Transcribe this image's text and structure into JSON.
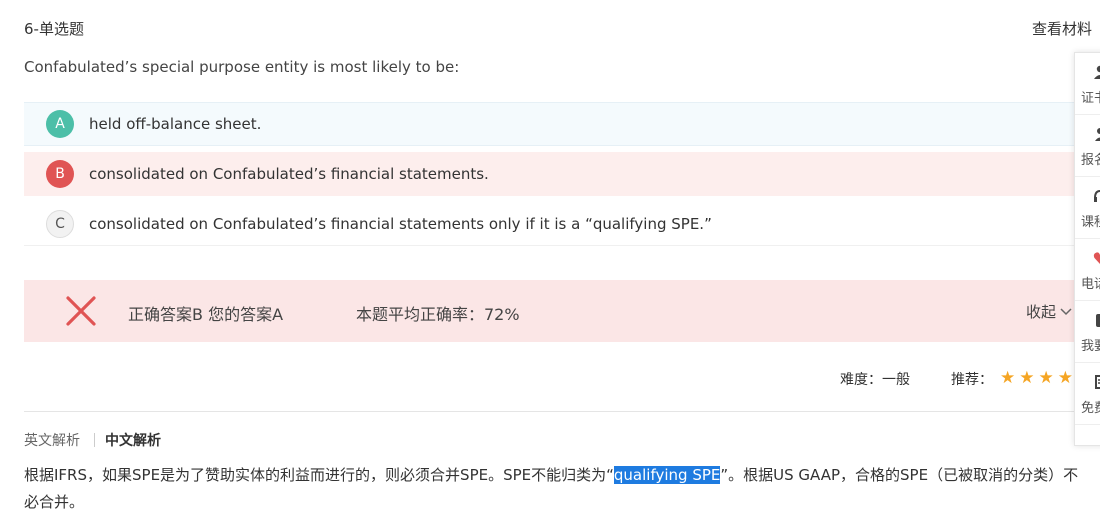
{
  "header": {
    "question_type": "6-单选题",
    "materials_link": "查看材料"
  },
  "question": {
    "text": "Confabulated’s special purpose entity is most likely to be:"
  },
  "options": [
    {
      "letter": "A",
      "text": "held off-balance sheet."
    },
    {
      "letter": "B",
      "text": "consolidated on Confabulated’s financial statements."
    },
    {
      "letter": "C",
      "text": "consolidated on Confabulated’s financial statements only if it is a “qualifying SPE.”"
    }
  ],
  "result": {
    "answer_text": "正确答案B 您的答案A",
    "accuracy_text": "本题平均正确率：72%",
    "collapse_label": "收起"
  },
  "meta": {
    "difficulty": "难度：一般",
    "recommend_label": "推荐：",
    "stars_shown": 4
  },
  "tabs": {
    "english": "英文解析",
    "chinese": "中文解析"
  },
  "explanation": {
    "before": "根据IFRS，如果SPE是为了赞助实体的利益而进行的，则必须合并SPE。SPE不能归类为“",
    "highlight": "qualifying SPE",
    "after": "”。根据US GAAP，合格的SPE（已被取消的分类）不必合并。"
  },
  "sidebar": {
    "items": [
      {
        "label": "证书",
        "icon": "person-icon"
      },
      {
        "label": "报名",
        "icon": "user-icon"
      },
      {
        "label": "课程",
        "icon": "headset-icon"
      },
      {
        "label": "电话",
        "icon": "heart-icon"
      },
      {
        "label": "我要",
        "icon": "phone-icon"
      },
      {
        "label": "免费",
        "icon": "document-icon"
      }
    ]
  },
  "colors": {
    "correct_badge": "#4cbfa8",
    "wrong_badge": "#e05454",
    "wrong_row_bg": "#fdeeed",
    "result_bg": "#fbe6e6",
    "star": "#f5a524",
    "highlight": "#1e7be0"
  }
}
